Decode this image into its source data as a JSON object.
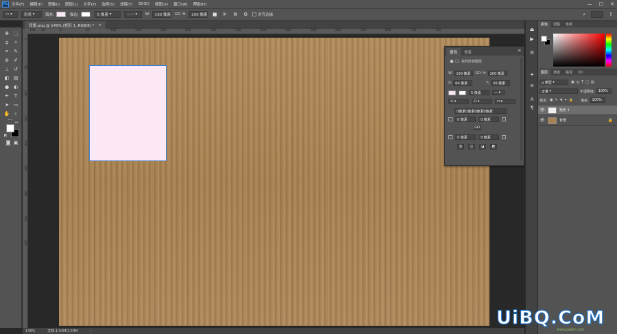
{
  "menubar": {
    "logo": "Ps",
    "items": [
      "文件(F)",
      "编辑(E)",
      "图像(I)",
      "图层(L)",
      "文字(Y)",
      "选择(S)",
      "滤镜(T)",
      "3D(D)",
      "视图(V)",
      "窗口(W)",
      "帮助(H)"
    ],
    "window_controls": [
      "—",
      "□",
      "✕"
    ]
  },
  "options": {
    "mode": "形状",
    "fill_label": "填充:",
    "fill_color": "#fde8f5",
    "stroke_label": "描边:",
    "stroke_width": "5 像素",
    "w_label": "W:",
    "w_value": "160 像素",
    "link_symbol": "GO",
    "h_label": "H:",
    "h_value": "200 像素",
    "align_edges": "对齐边缘"
  },
  "document": {
    "tab_title": "背景.png @ 149% (矩形 1, RGB/8) *",
    "close": "×",
    "shape_fill": "#fde8f5",
    "canvas_color": "#a98354"
  },
  "rulers": {
    "h": [
      "100",
      "50",
      "0",
      "50",
      "100",
      "150",
      "200",
      "250",
      "300",
      "350",
      "400",
      "450",
      "500",
      "550",
      "600",
      "650",
      "700",
      "750"
    ],
    "v": [
      "0",
      "50",
      "100",
      "150",
      "200",
      "250",
      "300",
      "350",
      "400"
    ]
  },
  "status": {
    "zoom": "149%",
    "doc": "文档:1.54M/1.54M"
  },
  "properties": {
    "tab1": "属性",
    "tab2": "信息",
    "menu": "≡",
    "section": "实时形状属性",
    "w_label": "W:",
    "w": "160 像素",
    "h_label": "H:",
    "h": "200 像素",
    "x_label": "X:",
    "x": "64 像素",
    "y_label": "Y:",
    "y": "56 像素",
    "stroke": "5 像素",
    "corners": "0像素0像素0像素0像素",
    "c1": "0 像素",
    "c2": "0 像素",
    "c3": "0 像素",
    "c4": "0 像素",
    "link": "GO"
  },
  "panels": {
    "color_tab": "颜色",
    "adjust_tab": "调整",
    "swatch_tab": "色板",
    "layers_tab": "图层",
    "channels_tab": "通道",
    "paths_tab": "路径",
    "threed_tab": "3D",
    "filter_kind": "ρ 类型",
    "blend_mode": "正常",
    "opacity_label": "不透明度:",
    "opacity": "100%",
    "lock_label": "锁定:",
    "fill_label": "填充:",
    "fill": "100%",
    "layers": [
      {
        "name": "矩形 1",
        "selected": true,
        "thumb": "#f0f0f0"
      },
      {
        "name": "背景",
        "selected": false,
        "thumb": "#a98354"
      }
    ]
  },
  "watermark": {
    "main": "UiBQ.CoM",
    "sub": "www.psahz.com"
  }
}
